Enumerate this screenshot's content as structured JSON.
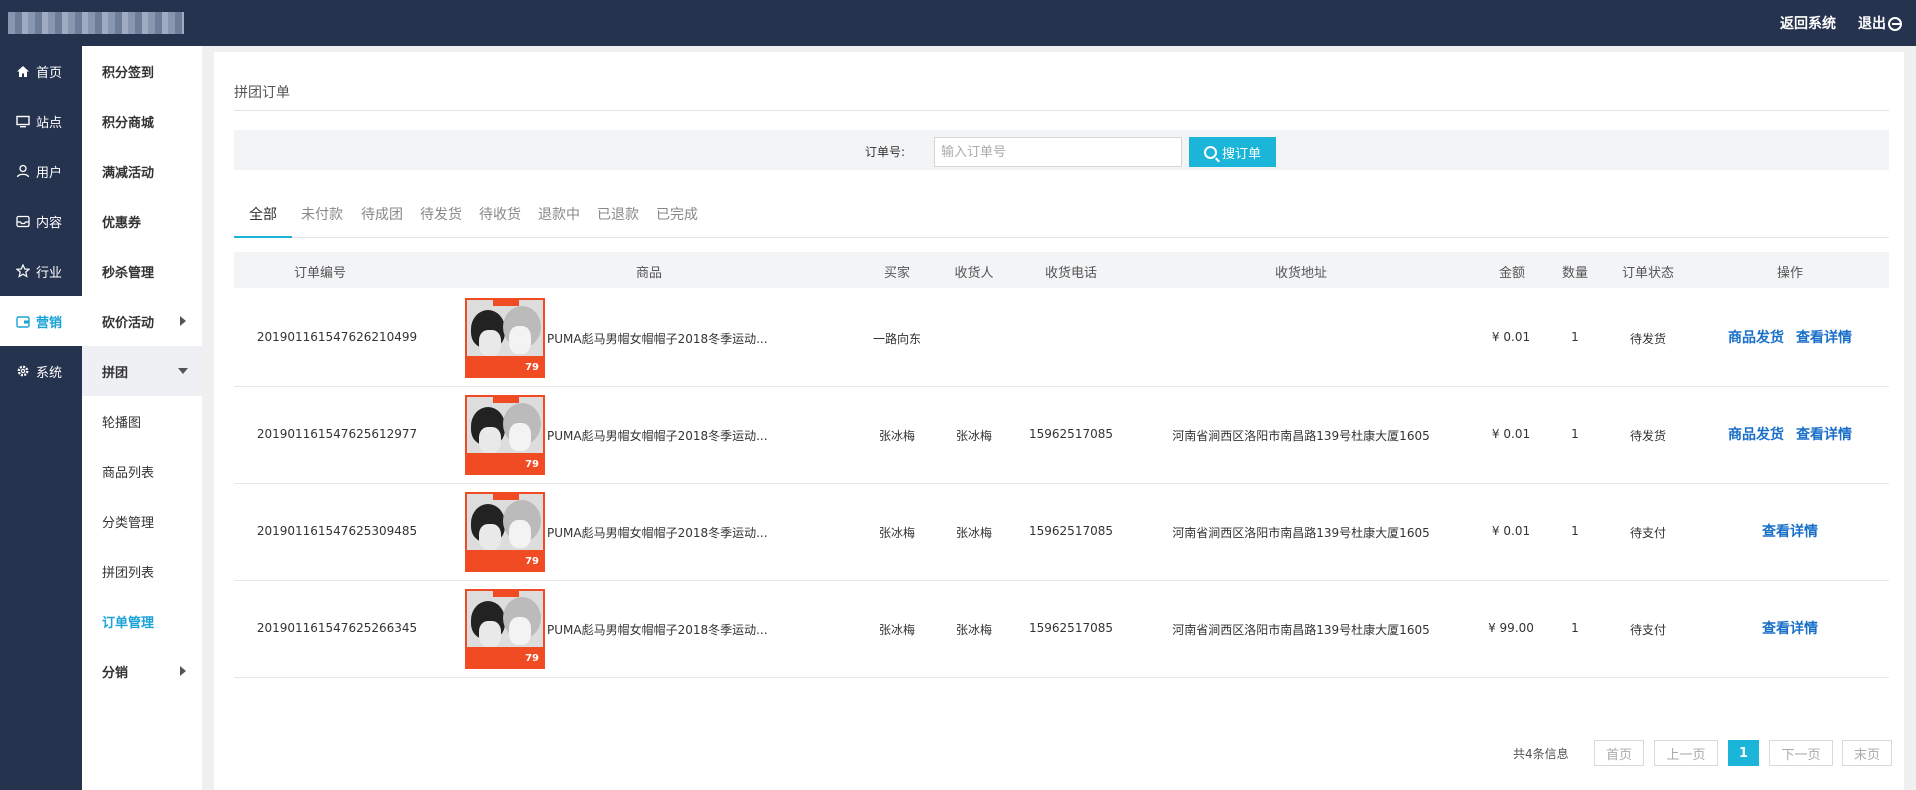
{
  "header": {
    "return_label": "返回系统",
    "logout_label": "退出"
  },
  "primary_nav": [
    {
      "label": "首页",
      "icon": "home-icon"
    },
    {
      "label": "站点",
      "icon": "monitor-icon"
    },
    {
      "label": "用户",
      "icon": "user-icon"
    },
    {
      "label": "内容",
      "icon": "inbox-icon"
    },
    {
      "label": "行业",
      "icon": "star-icon"
    },
    {
      "label": "营销",
      "icon": "wallet-icon",
      "active": true
    },
    {
      "label": "系统",
      "icon": "gear-icon"
    }
  ],
  "secondary_nav": [
    {
      "label": "积分签到"
    },
    {
      "label": "积分商城"
    },
    {
      "label": "满减活动"
    },
    {
      "label": "优惠券"
    },
    {
      "label": "秒杀管理"
    },
    {
      "label": "砍价活动"
    },
    {
      "label": "拼团"
    },
    {
      "label": "轮播图"
    },
    {
      "label": "商品列表"
    },
    {
      "label": "分类管理"
    },
    {
      "label": "拼团列表"
    },
    {
      "label": "订单管理"
    },
    {
      "label": "分销"
    }
  ],
  "page": {
    "title": "拼团订单"
  },
  "search": {
    "label": "订单号:",
    "placeholder": "输入订单号",
    "value": "",
    "button_label": "搜订单"
  },
  "tabs": [
    "全部",
    "未付款",
    "待成团",
    "待发货",
    "待收货",
    "退款中",
    "已退款",
    "已完成"
  ],
  "table": {
    "headers": [
      "订单编号",
      "商品",
      "买家",
      "收货人",
      "收货电话",
      "收货地址",
      "金额",
      "数量",
      "订单状态",
      "操作"
    ],
    "rows": [
      {
        "order_no": "2019011615476262104 99",
        "product": "PUMA彪马男帽女帽帽子2018冬季运动...",
        "buyer": "一路向东",
        "receiver": "",
        "phone": "",
        "address": "",
        "amount": "¥ 0.01",
        "qty": "1",
        "status": "待发货",
        "ship_label": "商品发货",
        "detail_label": "查看详情",
        "price_tag": "79"
      },
      {
        "order_no": "20190116154762561 2977",
        "product": "PUMA彪马男帽女帽帽子2018冬季运动...",
        "buyer": "张冰梅",
        "receiver": "张冰梅",
        "phone": "15962517085",
        "address": "河南省涧西区洛阳市南昌路139号杜康大厦1605",
        "amount": "¥ 0.01",
        "qty": "1",
        "status": "待发货",
        "ship_label": "商品发货",
        "detail_label": "查看详情",
        "price_tag": "79"
      },
      {
        "order_no": "2019011615476253094 85",
        "product": "PUMA彪马男帽女帽帽子2018冬季运动...",
        "buyer": "张冰梅",
        "receiver": "张冰梅",
        "phone": "15962517085",
        "address": "河南省涧西区洛阳市南昌路139号杜康大厦1605",
        "amount": "¥ 0.01",
        "qty": "1",
        "status": "待支付",
        "ship_label": "",
        "detail_label": "查看详情",
        "price_tag": "79"
      },
      {
        "order_no": "2019011615476252663 45",
        "product": "PUMA彪马男帽女帽帽子2018冬季运动...",
        "buyer": "张冰梅",
        "receiver": "张冰梅",
        "phone": "15962517085",
        "address": "河南省涧西区洛阳市南昌路139号杜康大厦1605",
        "amount": "¥ 99.00",
        "qty": "1",
        "status": "待支付",
        "ship_label": "",
        "detail_label": "查看详情",
        "price_tag": "79"
      }
    ]
  },
  "pagination": {
    "info": "共4条信息",
    "first": "首页",
    "prev": "上一页",
    "current": "1",
    "next": "下一页",
    "last": "末页"
  },
  "colors": {
    "topbar": "#26334f",
    "accent": "#1ab5d8",
    "link": "#1a6fc8",
    "product_border": "#f04b23"
  }
}
